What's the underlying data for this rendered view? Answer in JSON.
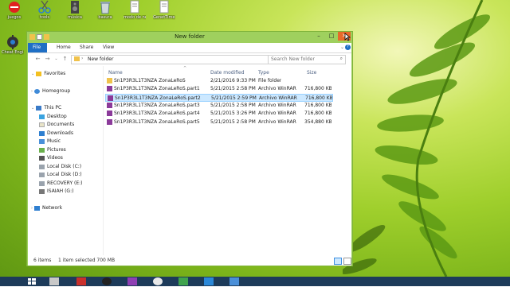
{
  "desktop_icons": [
    {
      "label": "juegos",
      "icon": "no-entry-icon"
    },
    {
      "label": "tools",
      "icon": "scissors-icon"
    },
    {
      "label": "música",
      "icon": "speaker-icon"
    },
    {
      "label": "basura",
      "icon": "recycle-bin-icon"
    },
    {
      "label": "modo de negrita ???",
      "icon": "document-icon"
    },
    {
      "label": "GenetTime...",
      "icon": "document-icon"
    },
    {
      "label": "Cheat Engi...",
      "icon": "cheat-engine-icon"
    }
  ],
  "window": {
    "title": "New folder",
    "tabs": [
      "File",
      "Home",
      "Share",
      "View"
    ],
    "address": "New folder",
    "search_placeholder": "Search New folder"
  },
  "nav": {
    "favorites": "Favorites",
    "homegroup": "Homegroup",
    "this_pc": "This PC",
    "pc_items": [
      "Desktop",
      "Documents",
      "Downloads",
      "Music",
      "Pictures",
      "Videos",
      "Local Disk (C:)",
      "Local Disk (D:)",
      "RECOVERY (E:)",
      "ISAIAH (G:)"
    ],
    "network": "Network"
  },
  "columns": [
    "Name",
    "Date modified",
    "Type",
    "Size"
  ],
  "files": [
    {
      "name": "Sn1P3R3L1T3NZA ZonaLeRoS",
      "date": "2/21/2016 9:33 PM",
      "type": "File folder",
      "size": "",
      "kind": "folder"
    },
    {
      "name": "Sn1P3R3L1T3NZA ZonaLeRoS.part1",
      "date": "5/21/2015 2:58 PM",
      "type": "Archivo WinRAR",
      "size": "716,800 KB",
      "kind": "rar"
    },
    {
      "name": "Sn1P3R3L1T3NZA ZonaLeRoS.part2",
      "date": "5/21/2015 2:59 PM",
      "type": "Archivo WinRAR",
      "size": "716,800 KB",
      "kind": "rar",
      "selected": true
    },
    {
      "name": "Sn1P3R3L1T3NZA ZonaLeRoS.part3",
      "date": "5/21/2015 2:58 PM",
      "type": "Archivo WinRAR",
      "size": "716,800 KB",
      "kind": "rar"
    },
    {
      "name": "Sn1P3R3L1T3NZA ZonaLeRoS.part4",
      "date": "5/21/2015 3:26 PM",
      "type": "Archivo WinRAR",
      "size": "716,800 KB",
      "kind": "rar"
    },
    {
      "name": "Sn1P3R3L1T3NZA ZonaLeRoS.part5",
      "date": "5/21/2015 2:58 PM",
      "type": "Archivo WinRAR",
      "size": "354,880 KB",
      "kind": "rar"
    }
  ],
  "status": {
    "items": "6 items",
    "selected": "1 item selected 700 MB"
  },
  "colors": {
    "accent": "#1f6fc5",
    "window_frame": "#9fd05e",
    "selection": "#cce8ff"
  }
}
